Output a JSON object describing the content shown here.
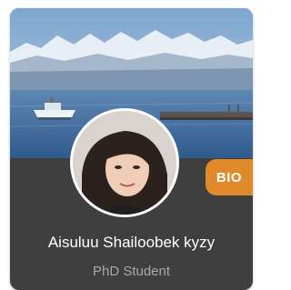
{
  "profile": {
    "name": "Aisuluu Shailoobek kyzy",
    "role": "PhD Student",
    "badge_label": "BIO"
  },
  "colors": {
    "card_bg": "#3f3f3f",
    "badge_bg": "#e08a2c",
    "name_text": "#ffffff",
    "role_text": "#a9a9a9"
  },
  "icons": [
    "cover-photo",
    "avatar-photo"
  ]
}
